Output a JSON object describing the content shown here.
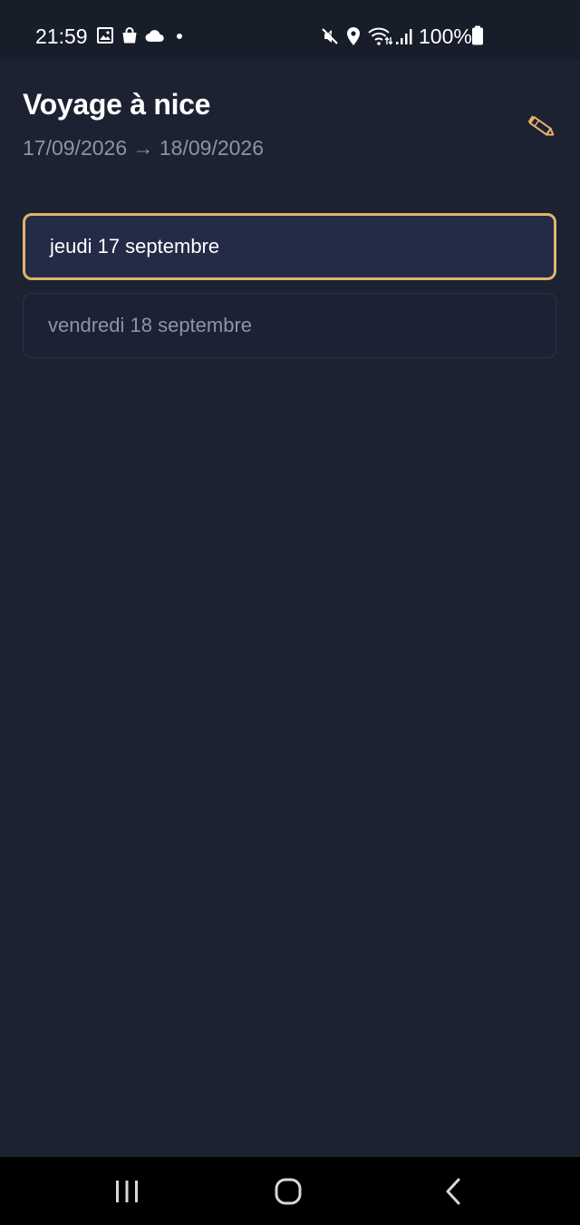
{
  "status_bar": {
    "time": "21:59",
    "battery": "100%",
    "icons": [
      "image-icon",
      "shopping-bag-icon",
      "cloud-icon",
      "dot-icon",
      "mute-icon",
      "location-icon",
      "wifi-icon",
      "signal-icon",
      "battery-icon"
    ]
  },
  "header": {
    "title": "Voyage à nice",
    "dates": "17/09/2026 → 18/09/2026",
    "edit_icon": "pencil-icon"
  },
  "days": [
    {
      "label": "jeudi 17 septembre",
      "selected": true
    },
    {
      "label": "vendredi 18 septembre",
      "selected": false
    }
  ],
  "colors": {
    "background": "#1d2233",
    "accent": "#e2b36a",
    "selected_bg": "#242b47",
    "muted_text": "#8c94a6"
  },
  "nav_bar": {
    "buttons": [
      "recent-apps-icon",
      "home-icon",
      "back-icon"
    ]
  }
}
